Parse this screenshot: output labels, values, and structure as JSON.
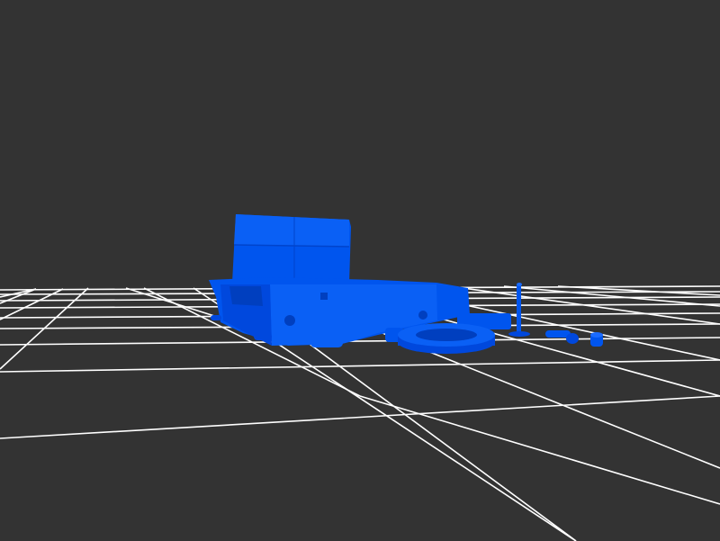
{
  "scene": {
    "background_color": "#333333",
    "grid_color": "#ffffff",
    "model_color": "#0055ee",
    "model_shadow_color": "#0044cc",
    "model_highlight_color": "#1a6bff"
  },
  "objects": [
    "main-body",
    "back-panel",
    "ring-part",
    "pin-part",
    "small-bolt",
    "small-cap"
  ]
}
